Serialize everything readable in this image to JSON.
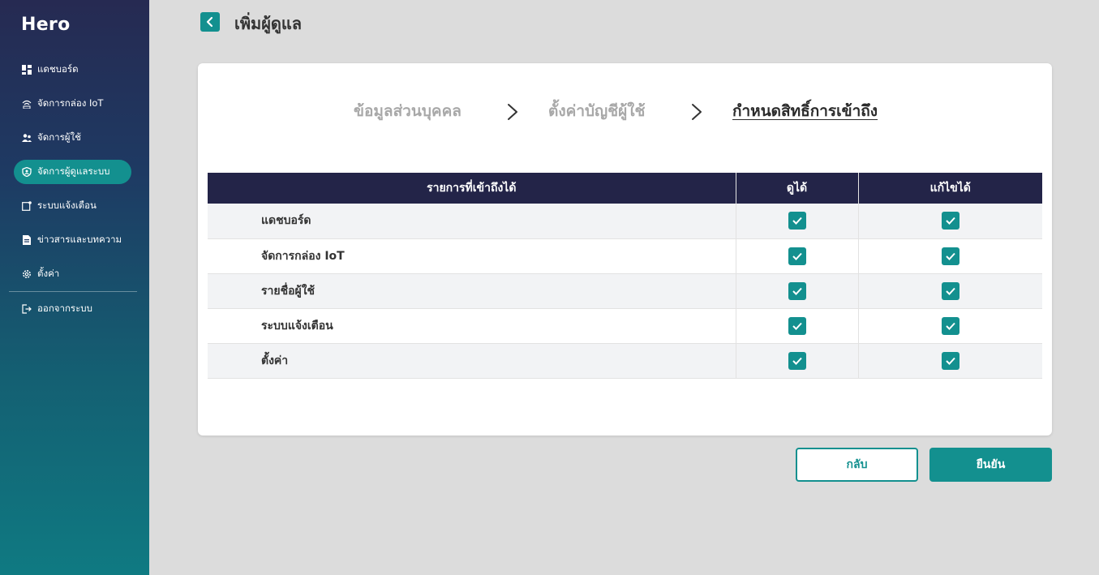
{
  "app": {
    "brand": "Hero"
  },
  "sidebar": {
    "items": [
      {
        "label": "แดชบอร์ด",
        "icon": "dashboard-icon",
        "active": false
      },
      {
        "label": "จัดการกล่อง IoT",
        "icon": "iot-signal-icon",
        "active": false
      },
      {
        "label": "จัดการผู้ใช้",
        "icon": "users-icon",
        "active": false
      },
      {
        "label": "จัดการผู้ดูแลระบบ",
        "icon": "admin-shield-icon",
        "active": true
      },
      {
        "label": "ระบบแจ้งเตือน",
        "icon": "notification-icon",
        "active": false
      },
      {
        "label": "ข่าวสารและบทความ",
        "icon": "news-icon",
        "active": false
      },
      {
        "label": "ตั้งค่า",
        "icon": "gear-icon",
        "active": false
      },
      {
        "label": "ออกจากระบบ",
        "icon": "logout-icon",
        "active": false
      }
    ]
  },
  "header": {
    "title": "เพิ่มผู้ดูแล"
  },
  "steps": [
    {
      "label": "ข้อมูลส่วนบุคคล",
      "current": false
    },
    {
      "label": "ตั้งค่าบัญชีผู้ใช้",
      "current": false
    },
    {
      "label": "กำหนดสิทธิ์การเข้าถึง",
      "current": true
    }
  ],
  "table": {
    "headers": [
      "รายการที่เข้าถึงได้",
      "ดูได้",
      "แก้ไขได้"
    ],
    "rows": [
      {
        "name": "แดชบอร์ด",
        "view": true,
        "edit": true
      },
      {
        "name": "จัดการกล่อง IoT",
        "view": true,
        "edit": true
      },
      {
        "name": "รายชื่อผู้ใช้",
        "view": true,
        "edit": true
      },
      {
        "name": "ระบบแจ้งเตือน",
        "view": true,
        "edit": true
      },
      {
        "name": "ตั้งค่า",
        "view": true,
        "edit": true
      }
    ]
  },
  "buttons": {
    "back": "กลับ",
    "confirm": "ยืนยัน"
  },
  "colors": {
    "accent": "#13908f",
    "table_header": "#232448",
    "sidebar_top": "#262a52",
    "sidebar_bottom": "#0f7a82"
  }
}
